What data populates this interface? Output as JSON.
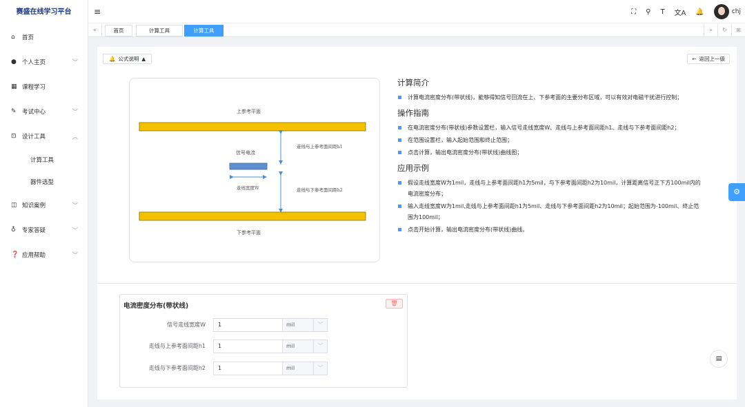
{
  "app": {
    "title": "赛盛在线学习平台"
  },
  "sidebar": {
    "items": [
      {
        "icon": "home-icon",
        "glyph": "⌂",
        "label": "首页",
        "chevron": ""
      },
      {
        "icon": "user-icon",
        "glyph": "●",
        "label": "个人主页",
        "chevron": "﹀"
      },
      {
        "icon": "course-icon",
        "glyph": "▦",
        "label": "课程学习",
        "chevron": ""
      },
      {
        "icon": "exam-icon",
        "glyph": "✎",
        "label": "考试中心",
        "chevron": "﹀"
      },
      {
        "icon": "toolbox-icon",
        "glyph": "⊡",
        "label": "设计工具",
        "chevron": "︿"
      },
      {
        "icon": "book-icon",
        "glyph": "◫",
        "label": "知识案例",
        "chevron": "﹀"
      },
      {
        "icon": "expert-icon",
        "glyph": "♁",
        "label": "专家答疑",
        "chevron": "﹀"
      },
      {
        "icon": "help-icon",
        "glyph": "❓",
        "label": "应用帮助",
        "chevron": "﹀"
      }
    ],
    "subitems": [
      "计算工具",
      "器件选型"
    ]
  },
  "header": {
    "hamburger": "≡",
    "icons": {
      "fullscreen": "⛶",
      "search": "⚲",
      "font": "T",
      "translate": "文A",
      "bell": "🔔"
    },
    "username": "chj"
  },
  "tabs": {
    "nav_left": "«",
    "nav_right": "»",
    "refresh": "↻",
    "grid": "⊞",
    "items": [
      {
        "label": "首页",
        "active": false
      },
      {
        "label": "计算工具",
        "active": false
      },
      {
        "label": "计算工具",
        "active": true
      }
    ]
  },
  "toolbar": {
    "formula_label": "公式说明",
    "formula_caret": "▲",
    "back_label": "返回上一级",
    "back_arrow": "←"
  },
  "diagram": {
    "top_plane": "上参考平面",
    "bottom_plane": "下参考平面",
    "signal": "信号电流",
    "width": "走线宽度W",
    "h1": "走线与上参考面间距h1",
    "h2": "走线与下参考面间距h2"
  },
  "intro": {
    "sections": [
      {
        "title": "计算简介",
        "bullets": [
          "计算电流密度分布(带状线)，能够得知信号回流在上、下参考面的主要分布区域，可以有效对电磁干扰进行控制；"
        ]
      },
      {
        "title": "操作指南",
        "bullets": [
          "在电流密度分布(带状线)参数设置栏，输入信号走线宽度W、走线与上参考面间距h1、走线与下参考面间距h2；",
          "在范围设置栏，输入起始范围和终止范围；",
          "点击计算，输出电流密度分布(带状线)曲线图；"
        ]
      },
      {
        "title": "应用示例",
        "bullets": [
          "假设走线宽度W为1mil，走线与上参考面间距h1为5mil，与下参考面间距h2为10mil，计算距离信号正下方100mil内的电流密度分布；",
          "输入走线宽度W为1mil,走线与上参考面间距h1为5mil、走线与下参考面间距h2为10mil；起始范围为-100mil、终止范围为100mil；",
          "点击开始计算，输出电流密度分布(带状线)曲线。"
        ]
      }
    ]
  },
  "params": {
    "title": "电流密度分布(带状线)",
    "delete_icon": "🗑",
    "rows": [
      {
        "label": "信号走线宽度W",
        "value": "1",
        "unit": "mil"
      },
      {
        "label": "走线与上参考面间距h1",
        "value": "1",
        "unit": "mil"
      },
      {
        "label": "走线与下参考面间距h2",
        "value": "1",
        "unit": "mil"
      }
    ],
    "caret": "﹀"
  },
  "floating": {
    "settings": "⚙",
    "chat": "▤"
  },
  "colors": {
    "accent": "#409eff",
    "plane": "#f5c000",
    "trace": "#5b8fcf"
  }
}
